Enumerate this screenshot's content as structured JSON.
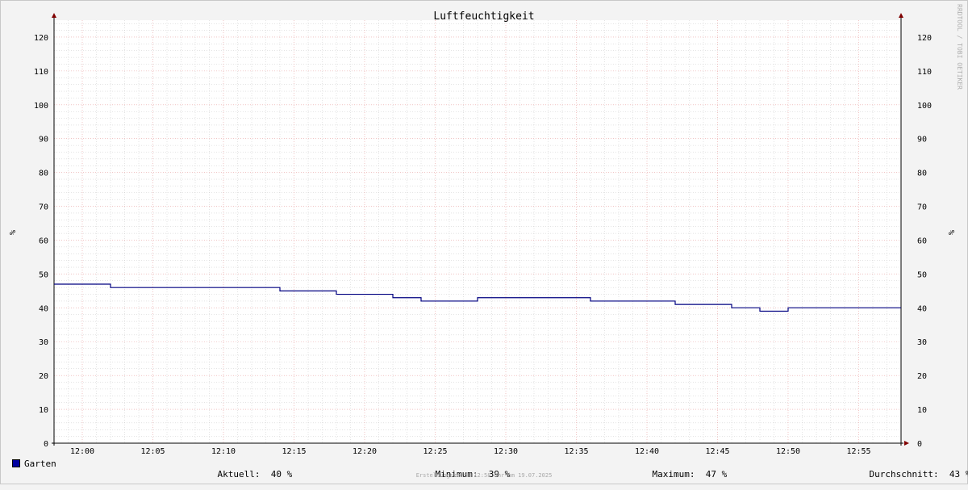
{
  "chart_data": {
    "type": "line",
    "title": "Luftfeuchtigkeit",
    "ylabel": "%",
    "ylim": [
      0,
      125
    ],
    "y_ticks": [
      0,
      10,
      20,
      30,
      40,
      50,
      60,
      70,
      80,
      90,
      100,
      110,
      120
    ],
    "xlim": [
      "11:58",
      "12:58"
    ],
    "x_ticks": [
      "12:00",
      "12:05",
      "12:10",
      "12:15",
      "12:20",
      "12:25",
      "12:30",
      "12:35",
      "12:40",
      "12:45",
      "12:50",
      "12:55"
    ],
    "grid": true,
    "step": true,
    "series": [
      {
        "name": "Garten",
        "color": "#000080",
        "x": [
          "11:58",
          "12:02",
          "12:14",
          "12:18",
          "12:22",
          "12:24",
          "12:28",
          "12:36",
          "12:42",
          "12:46",
          "12:48",
          "12:50"
        ],
        "values": [
          47,
          46,
          45,
          44,
          43,
          42,
          43,
          42,
          41,
          40,
          39,
          40
        ]
      }
    ]
  },
  "watermark": "RRDTOOL / TOBI OETIKER",
  "legend": {
    "series_name": "Garten",
    "swatch_color": "#0000a0",
    "current_label": "Aktuell:",
    "current_value": "40 %",
    "min_label": "Minimum:",
    "min_value": "39 %",
    "max_label": "Maximum:",
    "max_value": "47 %",
    "avg_label": "Durchschnitt:",
    "avg_value": "43 %"
  },
  "footer": "Erstellungszeit: 12:58 Uhr am 19.07.2025",
  "colors": {
    "major_grid": "#e8a0a0",
    "minor_grid": "#c8c8c8",
    "axis": "#000000",
    "arrow": "#800000",
    "plot_bg": "#ffffff"
  }
}
